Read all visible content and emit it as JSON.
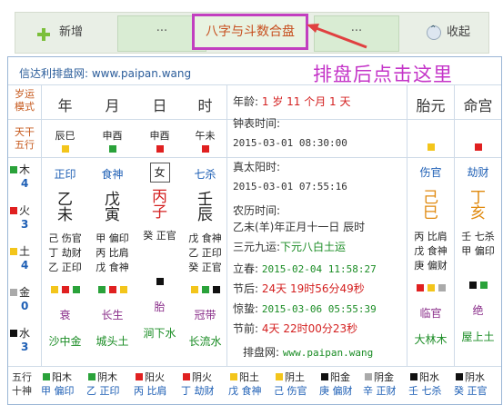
{
  "toolbar": {
    "new_label": "新增",
    "dots_left": "···",
    "active_tab": "八字与斗数合盘",
    "dots_right": "···",
    "collapse_label": "收起"
  },
  "annotation": {
    "text": "排盘后点击这里",
    "color": "#c434c8"
  },
  "panel": {
    "title": "信达利排盘网: www.paipan.wang",
    "row_labels": {
      "jiaoyun": [
        "岁运",
        "模式"
      ],
      "tiangan": [
        "天干",
        "五行"
      ]
    },
    "pillars": [
      {
        "name": "年",
        "ganzhi": "辰巳",
        "shishen": "正印",
        "gan": "乙",
        "zhi": "未",
        "canggan": [
          "己 伤官",
          "丁 劫财",
          "乙 正印"
        ],
        "state": "衰",
        "nayin": "沙中金"
      },
      {
        "name": "月",
        "ganzhi": "申酉",
        "shishen": "食神",
        "gan": "戊",
        "zhi": "寅",
        "canggan": [
          "甲 偏印",
          "丙 比肩",
          "戊 食神"
        ],
        "state": "长生",
        "nayin": "城头土"
      },
      {
        "name": "日",
        "ganzhi": "申酉",
        "shishen": "女",
        "gan": "丙",
        "zhi": "子",
        "canggan": [
          "癸 正官",
          "",
          ""
        ],
        "state": "胎",
        "nayin": "涧下水"
      },
      {
        "name": "时",
        "ganzhi": "午未",
        "shishen": "七杀",
        "gan": "壬",
        "zhi": "辰",
        "canggan": [
          "戊 食神",
          "乙 正印",
          "癸 正官"
        ],
        "state": "冠带",
        "nayin": "长流水"
      }
    ],
    "wuxing_counts": [
      {
        "name": "木",
        "count": "4"
      },
      {
        "name": "火",
        "count": "3"
      },
      {
        "name": "土",
        "count": "4"
      },
      {
        "name": "金",
        "count": "0"
      },
      {
        "name": "水",
        "count": "3"
      }
    ],
    "info": {
      "age_label": "年龄:",
      "age_value": "1 岁 11 个月 1 天",
      "clock_label": "钟表时间:",
      "clock_value": "2015-03-01 08:30:00",
      "solar_label": "真太阳时:",
      "solar_value": "2015-03-01 07:55:16",
      "lunar_label": "农历时间:",
      "lunar_value": "乙未(羊)年正月十一日 辰时",
      "yuan_label": "三元九运:",
      "yuan_value": "下元八白土运",
      "lichun_label": "立春:",
      "lichun_value": "2015-02-04 11:58:27",
      "jiehou_label": "节后:",
      "jiehou_value": "24天 19时56分49秒",
      "jingzhe_label": "惊蛰:",
      "jingzhe_value": "2015-03-06 05:55:39",
      "jieqian_label": "节前:",
      "jieqian_value": "4天 22时00分23秒",
      "site_label": "排盘网:",
      "site_value": "www.paipan.wang"
    },
    "taiyuan": {
      "title": "胎元",
      "shishen": "伤官",
      "gan": "己",
      "zhi": "巳",
      "canggan": [
        "丙 比肩",
        "戊 食神",
        "庚 偏财"
      ],
      "state": "临官",
      "nayin": "大林木"
    },
    "minggong": {
      "title": "命宫",
      "shishen": "劫财",
      "gan": "丁",
      "zhi": "亥",
      "canggan": [
        "壬 七杀",
        "甲 偏印",
        ""
      ],
      "state": "绝",
      "nayin": "屋上土"
    },
    "bottom": {
      "row1_label": "五行",
      "row2_label": "十神",
      "cells": [
        {
          "wx": "阳木",
          "ss": "甲 偏印"
        },
        {
          "wx": "阴木",
          "ss": "乙 正印"
        },
        {
          "wx": "阳火",
          "ss": "丙 比肩"
        },
        {
          "wx": "阴火",
          "ss": "丁 劫财"
        },
        {
          "wx": "阳土",
          "ss": "戊 食神"
        },
        {
          "wx": "阴土",
          "ss": "己 伤官"
        },
        {
          "wx": "阳金",
          "ss": "庚 偏财"
        },
        {
          "wx": "阴金",
          "ss": "辛 正财"
        },
        {
          "wx": "阳水",
          "ss": "壬 七杀"
        },
        {
          "wx": "阴水",
          "ss": "癸 正官"
        }
      ]
    }
  }
}
